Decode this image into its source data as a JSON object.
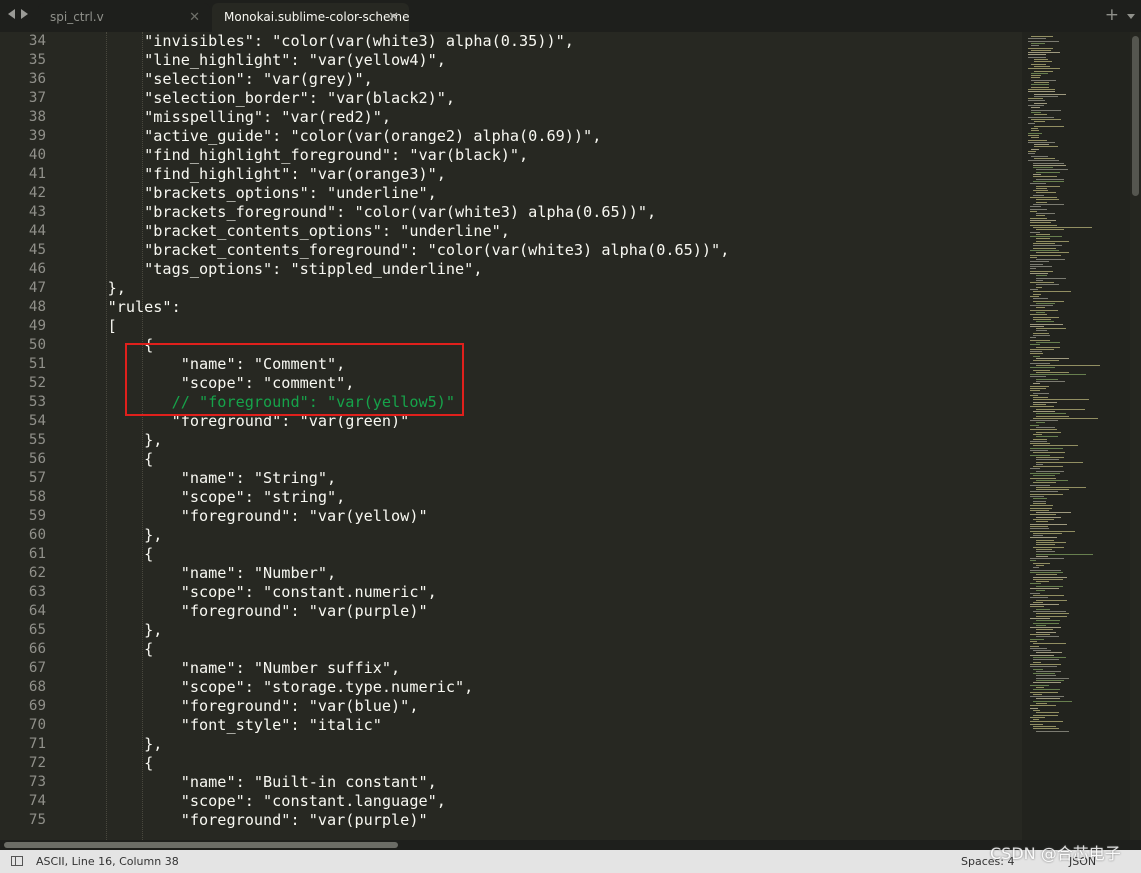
{
  "tabs": [
    {
      "title": "spi_ctrl.v",
      "active": false
    },
    {
      "title": "Monokai.sublime-color-scheme",
      "active": true
    }
  ],
  "tab_close_glyph": "✕",
  "new_tab_glyph": "+",
  "colors": {
    "background": "#272822",
    "key": "#f8f8f2",
    "comment": "#16a34a",
    "highlight_box": "#e0201c"
  },
  "editor": {
    "lines": [
      {
        "n": "34",
        "text": "        \"invisibles\": \"color(var(white3) alpha(0.35))\","
      },
      {
        "n": "35",
        "text": "        \"line_highlight\": \"var(yellow4)\","
      },
      {
        "n": "36",
        "text": "        \"selection\": \"var(grey)\","
      },
      {
        "n": "37",
        "text": "        \"selection_border\": \"var(black2)\","
      },
      {
        "n": "38",
        "text": "        \"misspelling\": \"var(red2)\","
      },
      {
        "n": "39",
        "text": "        \"active_guide\": \"color(var(orange2) alpha(0.69))\","
      },
      {
        "n": "40",
        "text": "        \"find_highlight_foreground\": \"var(black)\","
      },
      {
        "n": "41",
        "text": "        \"find_highlight\": \"var(orange3)\","
      },
      {
        "n": "42",
        "text": "        \"brackets_options\": \"underline\","
      },
      {
        "n": "43",
        "text": "        \"brackets_foreground\": \"color(var(white3) alpha(0.65))\","
      },
      {
        "n": "44",
        "text": "        \"bracket_contents_options\": \"underline\","
      },
      {
        "n": "45",
        "text": "        \"bracket_contents_foreground\": \"color(var(white3) alpha(0.65))\","
      },
      {
        "n": "46",
        "text": "        \"tags_options\": \"stippled_underline\","
      },
      {
        "n": "47",
        "text": "    },"
      },
      {
        "n": "48",
        "text": "    \"rules\":"
      },
      {
        "n": "49",
        "text": "    ["
      },
      {
        "n": "50",
        "text": "        {"
      },
      {
        "n": "51",
        "text": "            \"name\": \"Comment\","
      },
      {
        "n": "52",
        "text": "            \"scope\": \"comment\","
      },
      {
        "n": "53",
        "text": "           // \"foreground\": \"var(yellow5)\"",
        "comment": true
      },
      {
        "n": "54",
        "text": "           \"foreground\": \"var(green)\""
      },
      {
        "n": "55",
        "text": "        },"
      },
      {
        "n": "56",
        "text": "        {"
      },
      {
        "n": "57",
        "text": "            \"name\": \"String\","
      },
      {
        "n": "58",
        "text": "            \"scope\": \"string\","
      },
      {
        "n": "59",
        "text": "            \"foreground\": \"var(yellow)\""
      },
      {
        "n": "60",
        "text": "        },"
      },
      {
        "n": "61",
        "text": "        {"
      },
      {
        "n": "62",
        "text": "            \"name\": \"Number\","
      },
      {
        "n": "63",
        "text": "            \"scope\": \"constant.numeric\","
      },
      {
        "n": "64",
        "text": "            \"foreground\": \"var(purple)\""
      },
      {
        "n": "65",
        "text": "        },"
      },
      {
        "n": "66",
        "text": "        {"
      },
      {
        "n": "67",
        "text": "            \"name\": \"Number suffix\","
      },
      {
        "n": "68",
        "text": "            \"scope\": \"storage.type.numeric\","
      },
      {
        "n": "69",
        "text": "            \"foreground\": \"var(blue)\","
      },
      {
        "n": "70",
        "text": "            \"font_style\": \"italic\""
      },
      {
        "n": "71",
        "text": "        },"
      },
      {
        "n": "72",
        "text": "        {"
      },
      {
        "n": "73",
        "text": "            \"name\": \"Built-in constant\","
      },
      {
        "n": "74",
        "text": "            \"scope\": \"constant.language\","
      },
      {
        "n": "75",
        "text": "            \"foreground\": \"var(purple)\""
      }
    ]
  },
  "status_bar": {
    "encoding_position": "ASCII, Line 16, Column 38",
    "indentation": "Spaces: 4",
    "syntax": "JSON"
  },
  "watermark": "CSDN @合芯电子"
}
